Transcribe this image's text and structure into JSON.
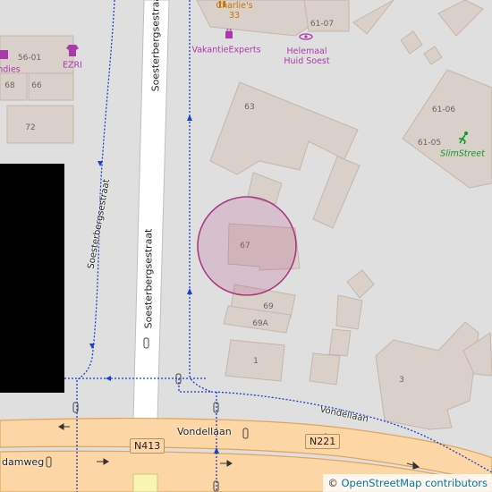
{
  "map": {
    "streets": {
      "soesterbergsestraat": "Soesterbergsestraat",
      "vondellaan": "Vondellaan",
      "vondellaan_upper": "Vondellaan",
      "road_left": "damweg"
    },
    "route_shields": {
      "n413": "N413",
      "n221": "N221"
    },
    "house_numbers": {
      "h63": "63",
      "h67": "67",
      "h69": "69",
      "h69a": "69A",
      "h1": "1",
      "h3": "3",
      "h72": "72",
      "h68": "68",
      "h66": "66",
      "h5601": "56-01",
      "h6107": "61-07",
      "h6106": "61-06",
      "h6105": "61-05",
      "h33": "33"
    },
    "pois": {
      "charlies": "Charlie's",
      "vakantie": "VakantieExperts",
      "helemaal_1": "Helemaal",
      "helemaal_2": "Huid Soest",
      "ezri": "EZRI",
      "andies": "ndies",
      "slimstreet": "SlimStreet"
    },
    "icons": [
      "fastfood-icon",
      "luggage-icon",
      "beauty-eye-icon",
      "shirt-icon",
      "shop-icon",
      "running-icon"
    ],
    "colors": {
      "background": "#e0dfdf",
      "building": "#d9d0c9",
      "building_outline": "#c4b6ab",
      "primary_road": "#fcd6a4",
      "primary_road_casing": "#e2a35c",
      "footway": "#1a3fcf",
      "poi": "#ac39ac",
      "marker": "#ac397f"
    },
    "attribution": {
      "symbol": "©",
      "link_text": "OpenStreetMap contributors"
    }
  }
}
